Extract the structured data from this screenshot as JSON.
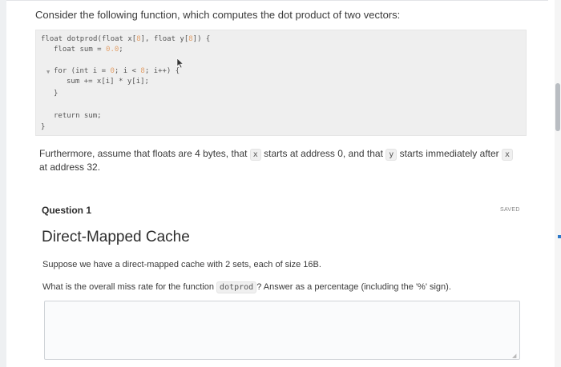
{
  "intro": "Consider the following function, which computes the dot product of two vectors:",
  "code": {
    "signature_pre": "float dotprod(float x[",
    "signature_n1": "8",
    "signature_mid": "], float y[",
    "signature_n2": "8",
    "signature_post": "]) {",
    "decl_pre": "float sum = ",
    "decl_val": "0.0",
    "decl_post": ";",
    "for_pre": "for (int i = ",
    "for_n1": "0",
    "for_mid": "; i < ",
    "for_n2": "8",
    "for_post": "; i++) {",
    "body": "sum += x[i] * y[i];",
    "close_inner": "}",
    "return": "return sum;",
    "close_outer": "}"
  },
  "para": {
    "p1": "Furthermore, assume that floats are 4 bytes, that ",
    "c1": "x",
    "p2": " starts at address 0, and that ",
    "c2": "y",
    "p3": " starts immediately after ",
    "c3": "x",
    "p4": " at address 32."
  },
  "question": {
    "label": "Question 1",
    "saved": "SAVED",
    "title": "Direct-Mapped Cache",
    "line1": "Suppose we have a direct-mapped cache with 2 sets, each of size 16B.",
    "line2_pre": "What is the overall miss rate for the function ",
    "line2_code": "dotprod",
    "line2_post": "? Answer as a percentage (including the '%' sign).",
    "answer_value": ""
  },
  "icons": {
    "cursor": "mouse-pointer-icon",
    "collapse": "chevron-down-icon",
    "resize": "resize-handle-icon"
  },
  "colors": {
    "code_number": "#e3a06a",
    "code_bg": "#efefef",
    "scroll_thumb": "#b9bdc2",
    "accent": "#2e79c9"
  }
}
